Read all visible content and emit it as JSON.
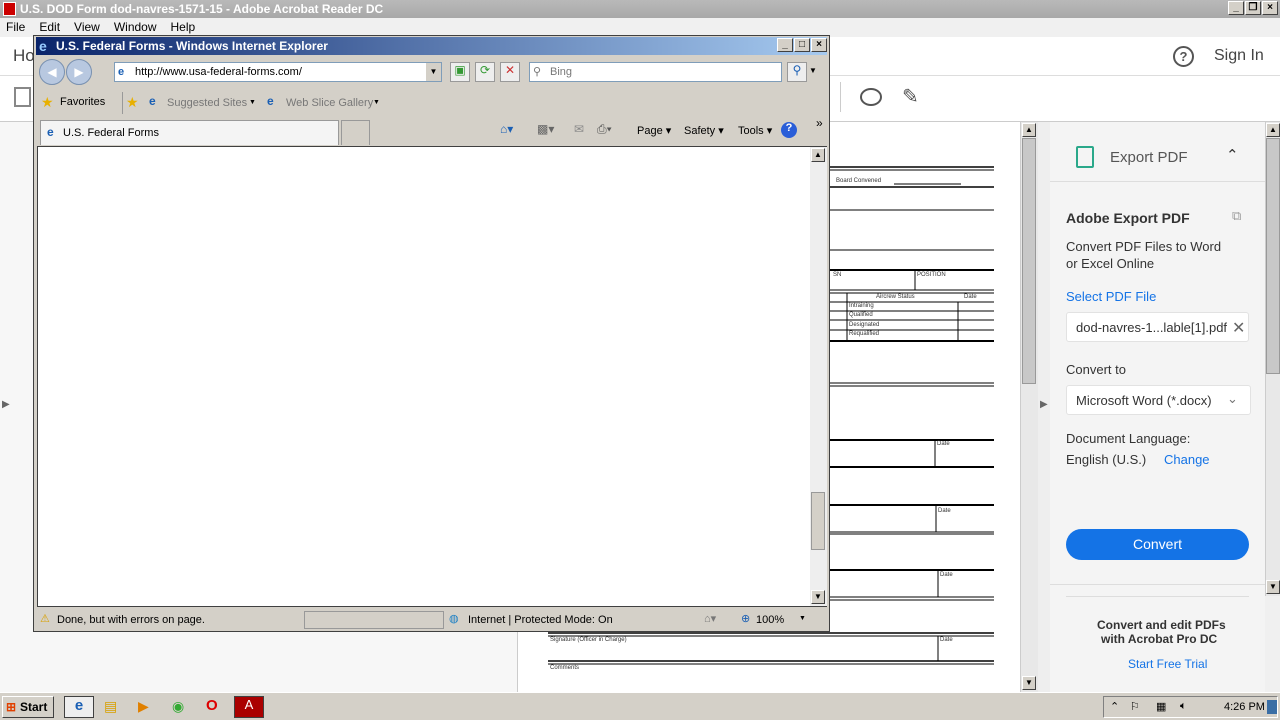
{
  "acrobat": {
    "title": "U.S. DOD Form dod-navres-1571-15 - Adobe Acrobat Reader DC",
    "menu": [
      "File",
      "Edit",
      "View",
      "Window",
      "Help"
    ],
    "home_tab": "Ho",
    "sign_in": "Sign In"
  },
  "form": {
    "board_convened": "Board Convened",
    "ssn": "SN",
    "position": "POSITION",
    "aircrew_status": "Aircrew Status",
    "date": "Date",
    "statuses": [
      "Intraining",
      "Qualified",
      "Designated",
      "Requalified"
    ],
    "signature": "Signature (Officer in Charge)",
    "comments": "Comments"
  },
  "export_panel": {
    "header": "Export PDF",
    "title": "Adobe Export PDF",
    "description_line1": "Convert PDF Files to Word",
    "description_line2": "or Excel Online",
    "select_label": "Select PDF File",
    "file_name": "dod-navres-1...lable[1].pdf",
    "convert_to_label": "Convert to",
    "convert_to_value": "Microsoft Word (*.docx)",
    "doc_lang_label": "Document Language:",
    "doc_lang_value": "English (U.S.)",
    "change_link": "Change",
    "convert_button": "Convert",
    "promo_line1": "Convert and edit PDFs",
    "promo_line2": "with Acrobat Pro DC",
    "trial_link": "Start Free Trial",
    "accent_color": "#1473e6"
  },
  "ie": {
    "title": "U.S. Federal Forms - Windows Internet Explorer",
    "address": "http://www.usa-federal-forms.com/",
    "search_placeholder": "Bing",
    "favorites": "Favorites",
    "suggested_sites": "Suggested Sites",
    "web_slice_gallery": "Web Slice Gallery",
    "tab_title": "U.S. Federal Forms",
    "cmd": {
      "page": "Page",
      "safety": "Safety",
      "tools": "Tools"
    },
    "status_text": "Done, but with errors on page.",
    "zone": "Internet | Protected Mode: On",
    "zoom": "100%"
  },
  "taskbar": {
    "start": "Start",
    "clock": "4:26 PM"
  }
}
